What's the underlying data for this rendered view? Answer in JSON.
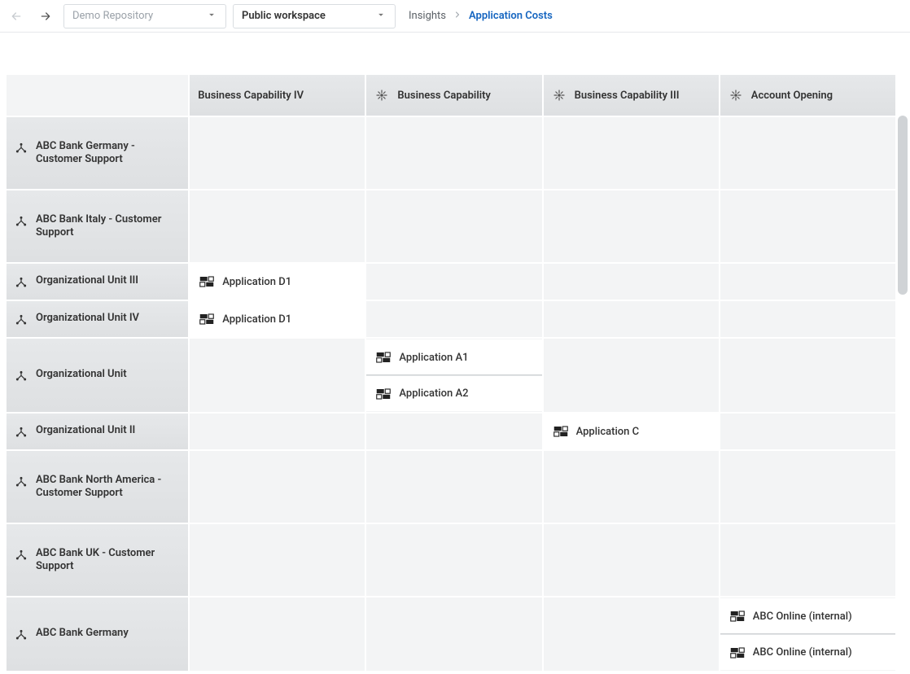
{
  "nav": {
    "repo_select": "Demo Repository",
    "workspace_select": "Public workspace",
    "breadcrumb": {
      "parent": "Insights",
      "current": "Application Costs"
    }
  },
  "matrix": {
    "columns": [
      {
        "label": "Business Capability IV",
        "icon": null
      },
      {
        "label": "Business Capability",
        "icon": "flower"
      },
      {
        "label": "Business Capability III",
        "icon": "flower"
      },
      {
        "label": "Account Opening",
        "icon": "flower"
      }
    ],
    "rows": [
      {
        "label": "ABC Bank Germany - Customer Support",
        "height": "tall",
        "cells": [
          [],
          [],
          [],
          []
        ]
      },
      {
        "label": "ABC Bank Italy - Customer Support",
        "height": "tall",
        "cells": [
          [],
          [],
          [],
          []
        ]
      },
      {
        "label": "Organizational Unit III",
        "height": "short",
        "cells": [
          [
            "Application D1"
          ],
          [],
          [],
          []
        ]
      },
      {
        "label": "Organizational Unit IV",
        "height": "short",
        "cells": [
          [
            "Application D1"
          ],
          [],
          [],
          []
        ]
      },
      {
        "label": "Organizational Unit",
        "height": "double",
        "cells": [
          [],
          [
            "Application A1",
            "Application A2"
          ],
          [],
          []
        ]
      },
      {
        "label": "Organizational Unit II",
        "height": "short",
        "cells": [
          [],
          [],
          [
            "Application C"
          ],
          []
        ]
      },
      {
        "label": "ABC Bank North America - Customer Support",
        "height": "tall",
        "cells": [
          [],
          [],
          [],
          []
        ]
      },
      {
        "label": "ABC Bank UK - Customer Support",
        "height": "tall",
        "cells": [
          [],
          [],
          [],
          []
        ]
      },
      {
        "label": "ABC Bank Germany",
        "height": "double",
        "cells": [
          [],
          [],
          [],
          [
            "ABC Online (internal)",
            "ABC Online (internal)"
          ]
        ]
      }
    ]
  }
}
